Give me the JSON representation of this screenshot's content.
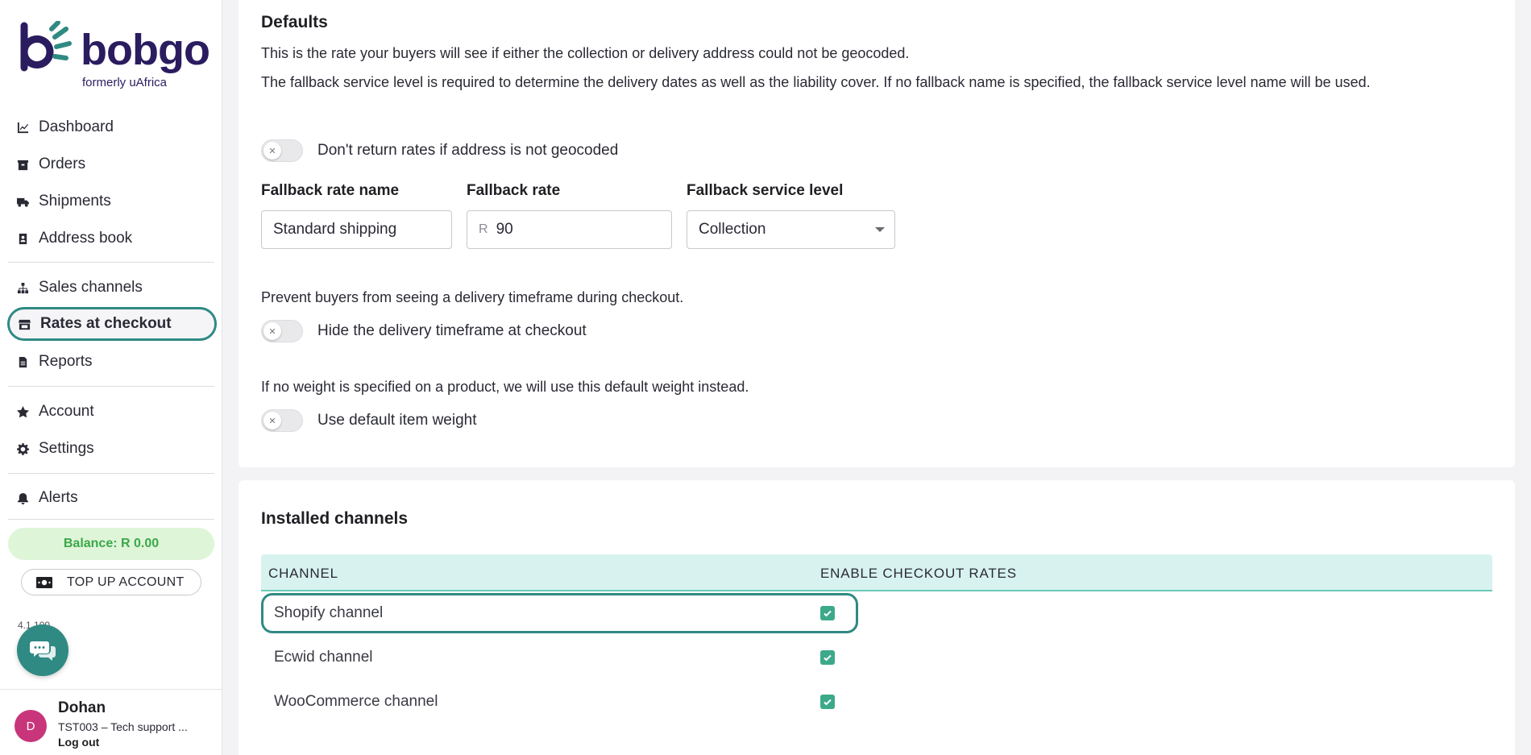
{
  "brand": {
    "name": "bobgo",
    "subtitle": "formerly uAfrica",
    "primary_color": "#2b1c60",
    "accent_color": "#2f8a83"
  },
  "sidebar": {
    "items": [
      {
        "label": "Dashboard",
        "icon": "chart-line-icon"
      },
      {
        "label": "Orders",
        "icon": "box-icon"
      },
      {
        "label": "Shipments",
        "icon": "truck-icon"
      },
      {
        "label": "Address book",
        "icon": "contact-book-icon"
      },
      {
        "label": "Sales channels",
        "icon": "sitemap-icon"
      },
      {
        "label": "Rates at checkout",
        "icon": "store-icon",
        "active": true
      },
      {
        "label": "Reports",
        "icon": "file-icon"
      },
      {
        "label": "Account",
        "icon": "star-icon"
      },
      {
        "label": "Settings",
        "icon": "gear-icon"
      },
      {
        "label": "Alerts",
        "icon": "bell-icon"
      }
    ],
    "balance": "Balance: R 0.00",
    "topup_label": "TOP UP ACCOUNT",
    "version": "4.1.100"
  },
  "user": {
    "initial": "D",
    "name": "Dohan",
    "org": "TST003 – Tech support ...",
    "logout_label": "Log out"
  },
  "defaults": {
    "title": "Defaults",
    "desc1": "This is the rate your buyers will see if either the collection or delivery address could not be geocoded.",
    "desc2": "The fallback service level is required to determine the delivery dates as well as the liability cover. If no fallback name is specified, the fallback service level name will be used.",
    "toggle_geocode": "Don't return rates if address is not geocoded",
    "fallback_name_label": "Fallback rate name",
    "fallback_name_value": "Standard shipping",
    "fallback_rate_label": "Fallback rate",
    "fallback_rate_prefix": "R",
    "fallback_rate_value": "90",
    "fallback_service_label": "Fallback service level",
    "fallback_service_value": "Collection",
    "timeframe_desc": "Prevent buyers from seeing a delivery timeframe during checkout.",
    "toggle_timeframe": "Hide the delivery timeframe at checkout",
    "weight_desc": "If no weight is specified on a product, we will use this default weight instead.",
    "toggle_weight": "Use default item weight"
  },
  "channels": {
    "title": "Installed channels",
    "col_channel": "CHANNEL",
    "col_enable": "ENABLE CHECKOUT RATES",
    "rows": [
      {
        "name": "Shopify channel",
        "enabled": true
      },
      {
        "name": "Ecwid channel",
        "enabled": true
      },
      {
        "name": "WooCommerce channel",
        "enabled": true
      }
    ]
  }
}
